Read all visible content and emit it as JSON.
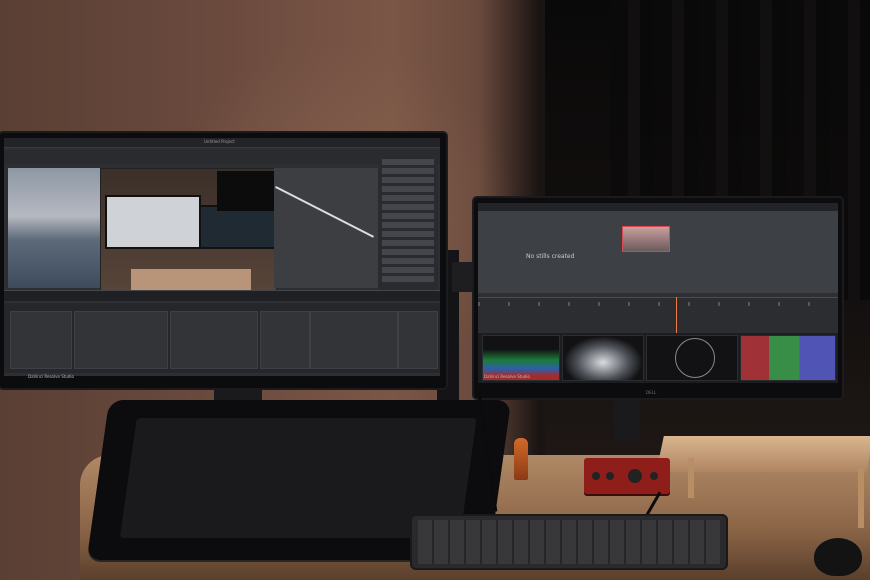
{
  "scene": {
    "description_tags": [
      "dual-monitor-desk",
      "video-editing",
      "pen-display"
    ]
  },
  "left_monitor": {
    "app_bar_label": "Untitled Project",
    "bottom_label": "DaVinci Resolve Studio"
  },
  "right_monitor": {
    "stills_message": "No stills created",
    "bottom_label": "DaVinci Resolve Studio",
    "brand": "DELL"
  },
  "accent_colors": {
    "playhead": "#f07a4a",
    "still_border": "#d9484f",
    "audio_interface": "#8f1e1a"
  }
}
